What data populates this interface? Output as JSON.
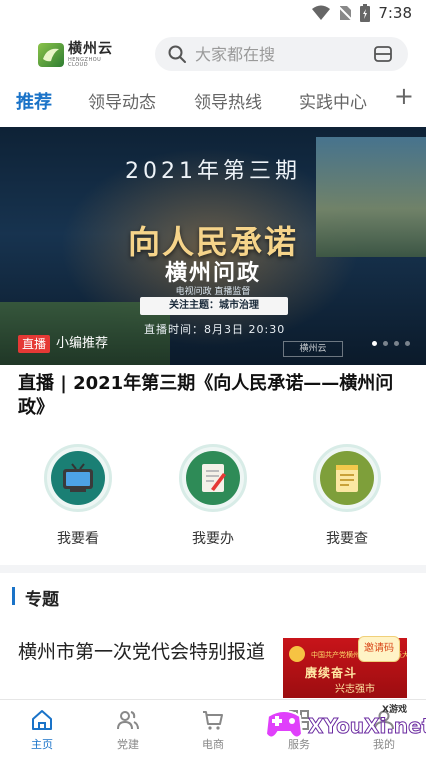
{
  "status_bar": {
    "time": "7:38"
  },
  "header": {
    "logo_cn": "横州云",
    "logo_en": "HENGZHOU CLOUD",
    "search_placeholder": "大家都在搜"
  },
  "tabs": [
    {
      "label": "推荐",
      "active": true
    },
    {
      "label": "领导动态",
      "active": false
    },
    {
      "label": "领导热线",
      "active": false
    },
    {
      "label": "实践中心",
      "active": false
    }
  ],
  "tab_add": "+",
  "banner": {
    "year_issue": "2021年第三期",
    "main_title": "向人民承诺",
    "sub_title": "横州问政",
    "tagline": "电视问政 直播监督",
    "topic": "关注主题：城市治理",
    "air_time": "直播时间：8月3日  20:30",
    "watermark": "横州云",
    "badge": "直播",
    "caption": "小编推荐",
    "slide_count": 4,
    "active_slide": 0
  },
  "headline": "直播 | 2021年第三期《向人民承诺——横州问政》",
  "quick_actions": [
    {
      "label": "我要看",
      "icon": "tv-icon",
      "color": "#1a7f74"
    },
    {
      "label": "我要办",
      "icon": "document-edit-icon",
      "color": "#2e8b57"
    },
    {
      "label": "我要查",
      "icon": "notepad-icon",
      "color": "#7e9f3a"
    }
  ],
  "section": {
    "title": "专题"
  },
  "topic_card": {
    "title": "横州市第一次党代会特别报道",
    "image_small": "中国共产党横州市第一次代表大会",
    "image_big": "赓续奋斗",
    "image_big2": "兴志强市",
    "invite": "邀请码"
  },
  "bottom_nav": [
    {
      "label": "主页",
      "icon": "home-icon",
      "active": true
    },
    {
      "label": "党建",
      "icon": "people-icon",
      "active": false
    },
    {
      "label": "电商",
      "icon": "cart-icon",
      "active": false
    },
    {
      "label": "服务",
      "icon": "grid-icon",
      "active": false
    },
    {
      "label": "我的",
      "icon": "user-icon",
      "active": false
    }
  ],
  "watermark_overlay": {
    "brand": "XYouXi.net",
    "small": "X游戏"
  },
  "colors": {
    "accent": "#1a73c8",
    "live": "#e53935"
  }
}
